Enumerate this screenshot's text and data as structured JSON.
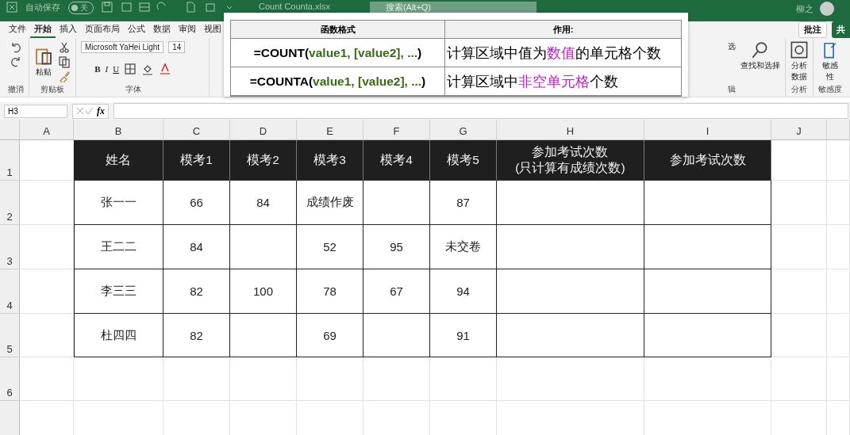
{
  "title_bar": {
    "autosave_label": "自动保存",
    "autosave_toggle": {
      "label": "关",
      "on": false
    },
    "file_name": "Count Counta.xlsx",
    "search_placeholder": "搜索(Alt+Q)",
    "user": "柳之"
  },
  "menu_tabs": [
    {
      "label": "文件",
      "selected": false
    },
    {
      "label": "开始",
      "selected": true
    },
    {
      "label": "插入",
      "selected": false
    },
    {
      "label": "页面布局",
      "selected": false
    },
    {
      "label": "公式",
      "selected": false
    },
    {
      "label": "数据",
      "selected": false
    },
    {
      "label": "审阅",
      "selected": false
    },
    {
      "label": "视图",
      "selected": false
    }
  ],
  "comment_button": "批注",
  "share_button": "共",
  "ribbon": {
    "undo_group": "撤消",
    "paste": "粘贴",
    "clipboard_group": "剪贴板",
    "font_name": "Microsoft YaHei Light",
    "font_size": "14",
    "bold": "B",
    "italic": "I",
    "underline": "U",
    "font_group": "字体",
    "sort_fragment": "选",
    "find_select": "查找和选择",
    "analyze": "分析数据",
    "analyze_group": "分析",
    "sensitivity": "敏感性",
    "sensitivity_group": "敏感度",
    "edit_fragment": "辑"
  },
  "formula_bar": {
    "name_box": "H3",
    "fx": "fx"
  },
  "popup": {
    "headers": [
      "函数格式",
      "作用:"
    ],
    "rows": [
      {
        "function": "=COUNT(",
        "args": "value1, [value2], ...",
        "close": ")",
        "before": "计算区域中值为",
        "highlight": "数值",
        "after": "的单元格个数"
      },
      {
        "function": "=COUNTA(",
        "args": "value1, [value2], ...",
        "close": ")",
        "before": "计算区域中",
        "highlight": "非空单元格",
        "after": "个数"
      }
    ]
  },
  "sheet": {
    "column_letters": [
      "A",
      "B",
      "C",
      "D",
      "E",
      "F",
      "G",
      "H",
      "I",
      "J"
    ],
    "row_numbers": [
      "1",
      "2",
      "3",
      "4",
      "5",
      "6"
    ],
    "header": [
      "姓名",
      "模考1",
      "模考2",
      "模考3",
      "模考4",
      "模考5",
      "参加考试次数\n(只计算有成绩次数)",
      "参加考试次数"
    ],
    "rows": [
      [
        "张一一",
        "66",
        "84",
        "成绩作废",
        null,
        "87",
        null,
        null
      ],
      [
        "王二二",
        "84",
        null,
        "52",
        "95",
        "未交卷",
        null,
        null
      ],
      [
        "李三三",
        "82",
        "100",
        "78",
        "67",
        "94",
        null,
        null
      ],
      [
        "杜四四",
        "82",
        null,
        "69",
        null,
        "91",
        null,
        null
      ]
    ]
  }
}
